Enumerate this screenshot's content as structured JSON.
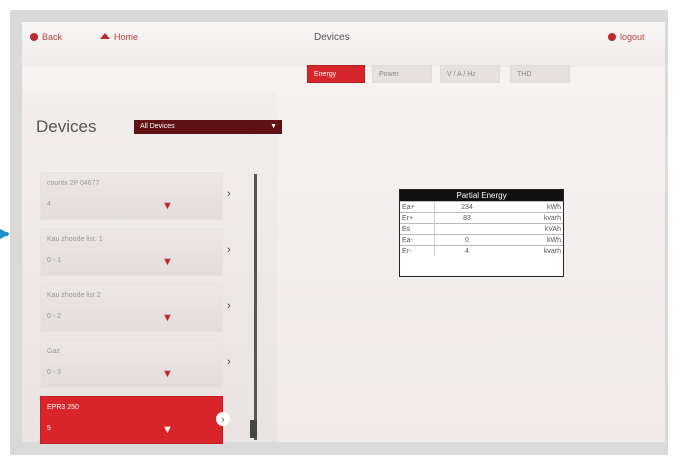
{
  "topbar": {
    "back_label": "Back",
    "home_label": "Home",
    "title": "Devices",
    "logout_label": "logout"
  },
  "tabs": [
    {
      "label": "Energy",
      "active": true
    },
    {
      "label": "Power",
      "active": false
    },
    {
      "label": "V / A / Hz",
      "active": false
    },
    {
      "label": "THD",
      "active": false
    }
  ],
  "sidebar": {
    "heading": "Devices",
    "filter_selected": "All Devices",
    "devices": [
      {
        "name": "countx 2P 04677",
        "sub": "4",
        "selected": false
      },
      {
        "name": "Kau zhoode list. 1",
        "sub": "0 - 1",
        "selected": false
      },
      {
        "name": "Kau zhoode list 2",
        "sub": "0 - 2",
        "selected": false
      },
      {
        "name": "Gaz",
        "sub": "0 - 3",
        "selected": false
      },
      {
        "name": "EPR3 250",
        "sub": "5",
        "selected": true
      }
    ]
  },
  "partial_energy": {
    "title": "Partial Energy",
    "rows": [
      {
        "label": "Ea+",
        "value": "234",
        "unit": "kWh"
      },
      {
        "label": "Er+",
        "value": "83",
        "unit": "kvarh"
      },
      {
        "label": "Es",
        "value": "",
        "unit": "kVAh"
      },
      {
        "label": "Ea-",
        "value": "0",
        "unit": "kWh"
      },
      {
        "label": "Er-",
        "value": "4",
        "unit": "kvarh"
      }
    ]
  },
  "colors": {
    "accent": "#d6262b",
    "select_bg": "#5f1214",
    "pointer": "#1b8fcf"
  },
  "icons": {
    "wifi": "wifi-icon",
    "chevron": "chevron-right-icon"
  }
}
